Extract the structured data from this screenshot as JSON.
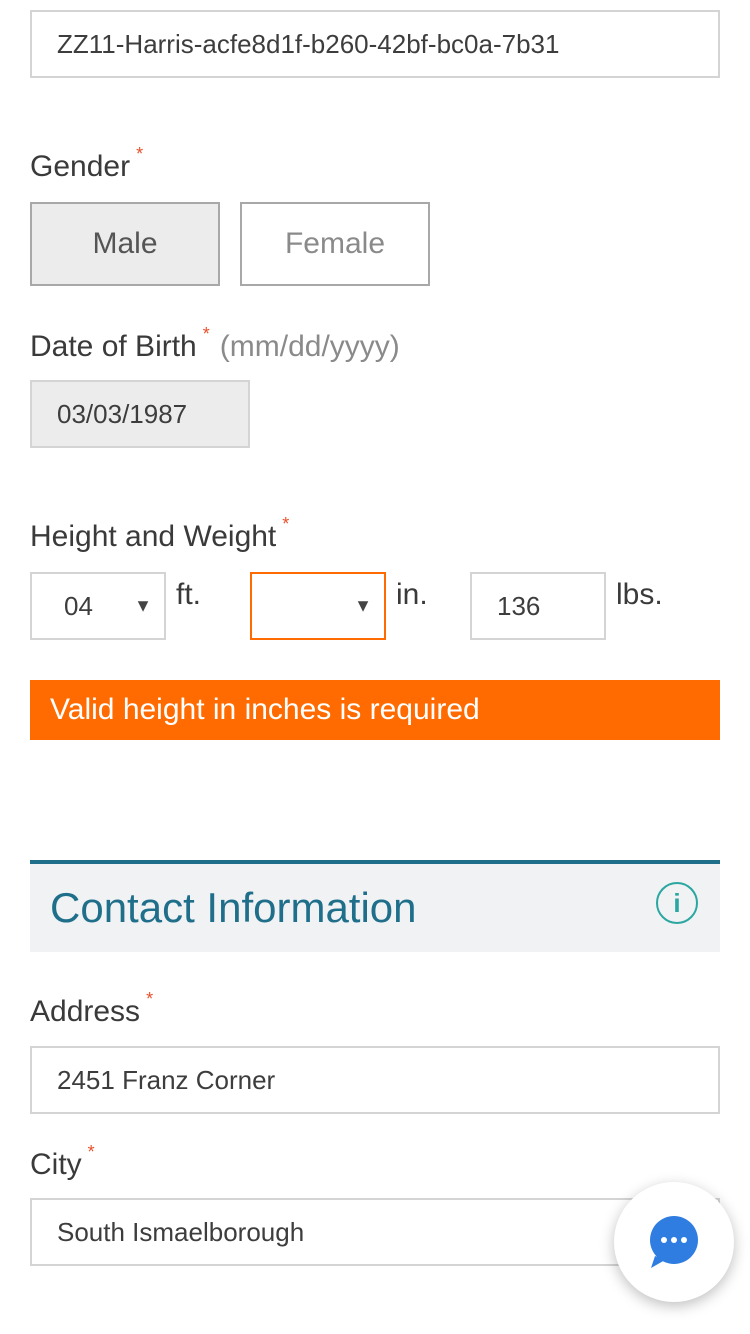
{
  "fields": {
    "id_value": "ZZ11-Harris-acfe8d1f-b260-42bf-bc0a-7b31",
    "gender": {
      "label": "Gender",
      "required_mark": "*",
      "male": "Male",
      "female": "Female"
    },
    "dob": {
      "label": "Date of Birth",
      "required_mark": "*",
      "hint": "(mm/dd/yyyy)",
      "value": "03/03/1987"
    },
    "height_weight": {
      "label": "Height and Weight",
      "required_mark": "*",
      "feet_value": "04",
      "feet_unit": "ft.",
      "inches_value": "",
      "inches_unit": "in.",
      "weight_value": "136",
      "weight_unit": "lbs.",
      "error": "Valid height in inches is required"
    }
  },
  "contact": {
    "title": "Contact Information",
    "info_icon": "i",
    "address": {
      "label": "Address",
      "required_mark": "*",
      "value": "2451 Franz Corner"
    },
    "city": {
      "label": "City",
      "required_mark": "*",
      "value": "South Ismaelborough"
    }
  },
  "chat": {
    "icon": "chat-bubble-icon",
    "dots": "•••"
  },
  "colors": {
    "accent_orange": "#ff6b00",
    "header_teal": "#1f6f8b",
    "section_bg": "#f0f2f4",
    "required_red": "#e8502a"
  }
}
